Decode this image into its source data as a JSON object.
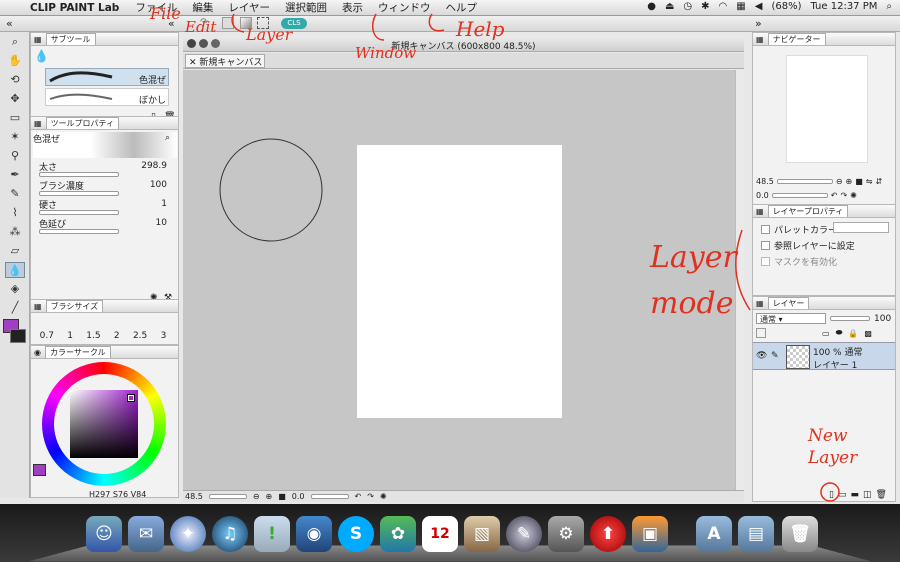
{
  "menubar": {
    "app": "CLIP PAINT Lab",
    "items": [
      "ファイル",
      "編集",
      "レイヤー",
      "選択範囲",
      "表示",
      "ウィンドウ",
      "ヘルプ"
    ],
    "battery": "(68%)",
    "clock": "Tue 12:37 PM"
  },
  "document_title": "新規キャンバス (600x800 48.5%)",
  "canvas_tab": "新規キャンバス",
  "subtool": {
    "title": "サブツール",
    "items": [
      "色混ぜ",
      "ぼかし"
    ]
  },
  "tool_property": {
    "title": "ツールプロパティ",
    "preview_label": "色混ぜ",
    "props": [
      {
        "label": "太さ",
        "value": "298.9"
      },
      {
        "label": "ブラシ濃度",
        "value": "100"
      },
      {
        "label": "硬さ",
        "value": "1"
      },
      {
        "label": "色延び",
        "value": "10"
      }
    ]
  },
  "brush_size": {
    "title": "ブラシサイズ",
    "values": [
      "0.7",
      "1",
      "1.5",
      "2",
      "2.5",
      "3"
    ]
  },
  "color_circle": {
    "title": "カラーサークル",
    "h": "297",
    "s": "76",
    "v": "84",
    "main_color": "#a040c0"
  },
  "status": {
    "zoom": "48.5",
    "angle": "0.0"
  },
  "navigator": {
    "title": "ナビゲーター",
    "zoom": "48.5",
    "angle": "0.0"
  },
  "layer_property": {
    "title": "レイヤープロパティ",
    "options": [
      "パレットカラー",
      "参照レイヤーに設定",
      "マスクを有効化"
    ]
  },
  "layer_panel": {
    "title": "レイヤー",
    "blend_mode": "通常",
    "opacity": "100",
    "layers": [
      {
        "mode": "100 % 通常",
        "name": "レイヤー 1"
      }
    ]
  },
  "annotations": {
    "file": "File",
    "edit": "Edit",
    "layer": "Layer",
    "window": "Window",
    "help": "Help",
    "layer_mode": "Layer mode",
    "new_layer": "New Layer"
  },
  "dock": {
    "calendar_day": "12"
  }
}
